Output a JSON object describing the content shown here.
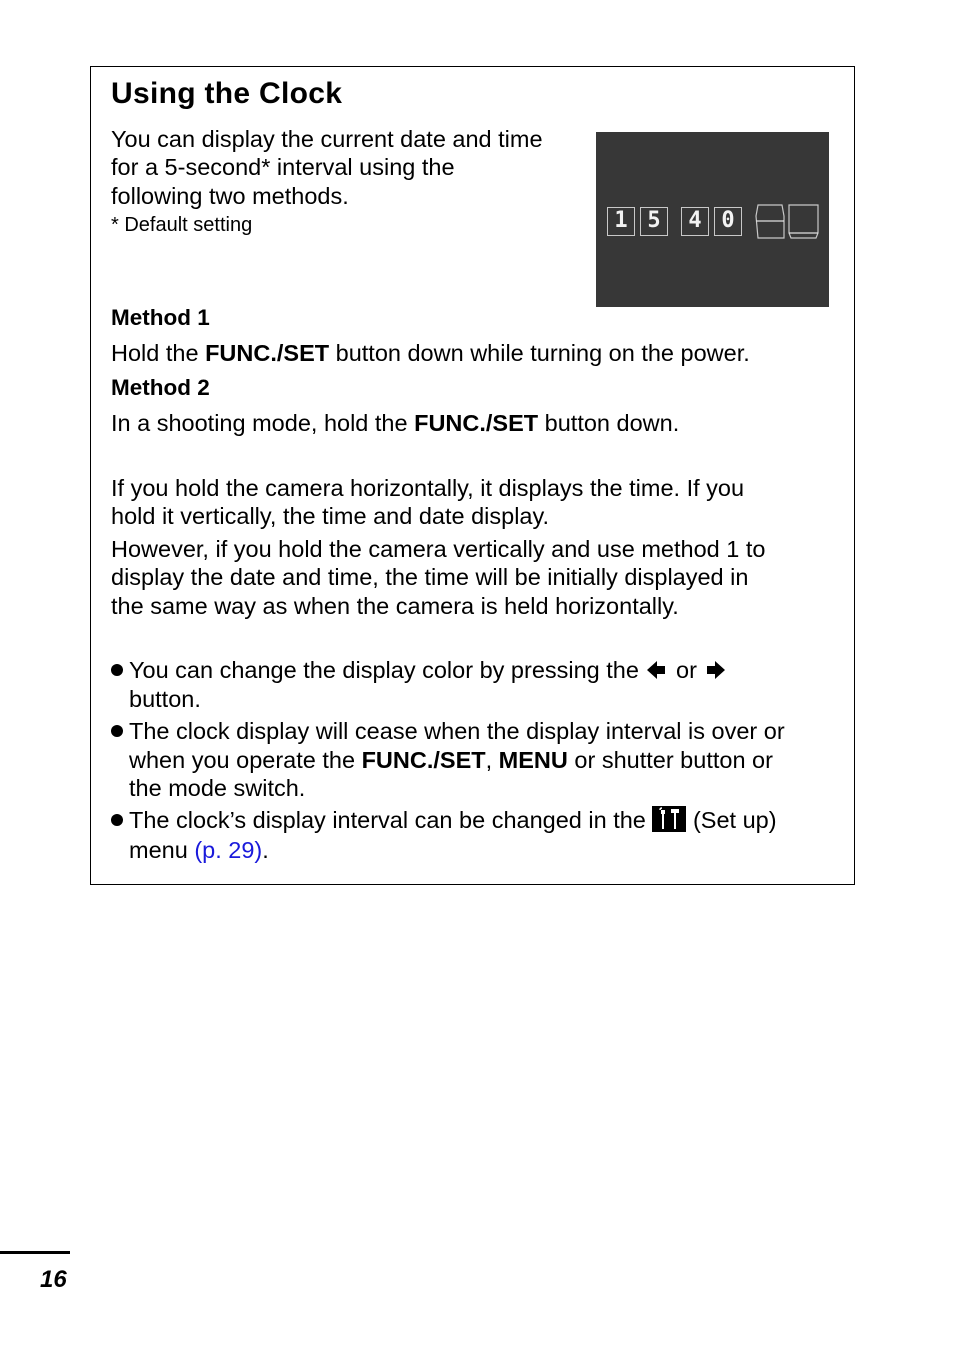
{
  "section": {
    "title": "Using the Clock",
    "intro_lines": [
      "You can display the current date and time",
      "for a 5-second* interval using the",
      "following two methods."
    ],
    "footnote": "*  Default setting"
  },
  "clock_display": {
    "digits": [
      "1",
      "5",
      "4",
      "0"
    ],
    "time_text": "15 40",
    "background_color": "#373737"
  },
  "methods": [
    {
      "heading": "Method 1",
      "pre": "Hold the ",
      "bold": "FUNC./SET",
      "post": " button down while turning on the power."
    },
    {
      "heading": "Method 2",
      "pre": "In a shooting mode, hold the ",
      "bold": "FUNC./SET",
      "post": " button down."
    }
  ],
  "paragraphs": [
    [
      "If you hold the camera horizontally, it displays the time. If you",
      "hold it vertically, the time and date display."
    ],
    [
      "However, if you hold the camera vertically and use method 1 to",
      "display the date and time, the time will be initially displayed in",
      "the same way as when the camera is held horizontally."
    ]
  ],
  "bullets": {
    "b1_line1_pre": "You can change the display color by pressing the",
    "b1_or": "or",
    "b1_line2": "button.",
    "b2_line1": "The clock display will cease when the display interval is over or",
    "b2_line2_pre": "when you operate the ",
    "b2_func": "FUNC./SET",
    "b2_comma": ", ",
    "b2_menu": "MENU",
    "b2_line2_post": " or shutter button or",
    "b2_line3": "the mode switch.",
    "b3_line1_pre": "The clock’s display interval can be changed in the",
    "b3_setup": "(Set up)",
    "b3_line2_pre": "menu ",
    "b3_link": "(p. 29)",
    "b3_line2_post": "."
  },
  "page_number": "16",
  "colors": {
    "link": "#1a1adb"
  }
}
